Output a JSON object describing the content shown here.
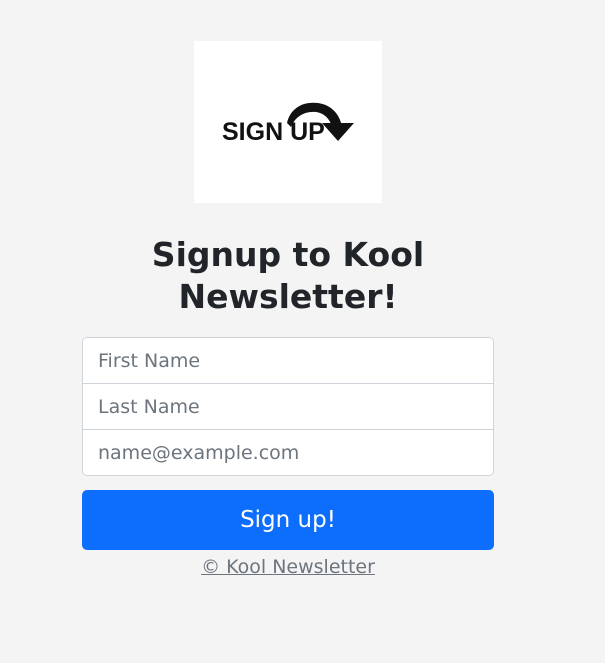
{
  "logo": {
    "text": "SIGN UP",
    "icon": "curved-arrow-down-icon"
  },
  "heading": "Signup to Kool Newsletter!",
  "form": {
    "first_name_placeholder": "First Name",
    "last_name_placeholder": "Last Name",
    "email_placeholder": "name@example.com",
    "submit_label": "Sign up!"
  },
  "footer": {
    "copyright": "© Kool Newsletter"
  },
  "colors": {
    "background": "#f4f4f4",
    "primary": "#0d6efd",
    "text": "#212529",
    "muted": "#6c757d"
  }
}
